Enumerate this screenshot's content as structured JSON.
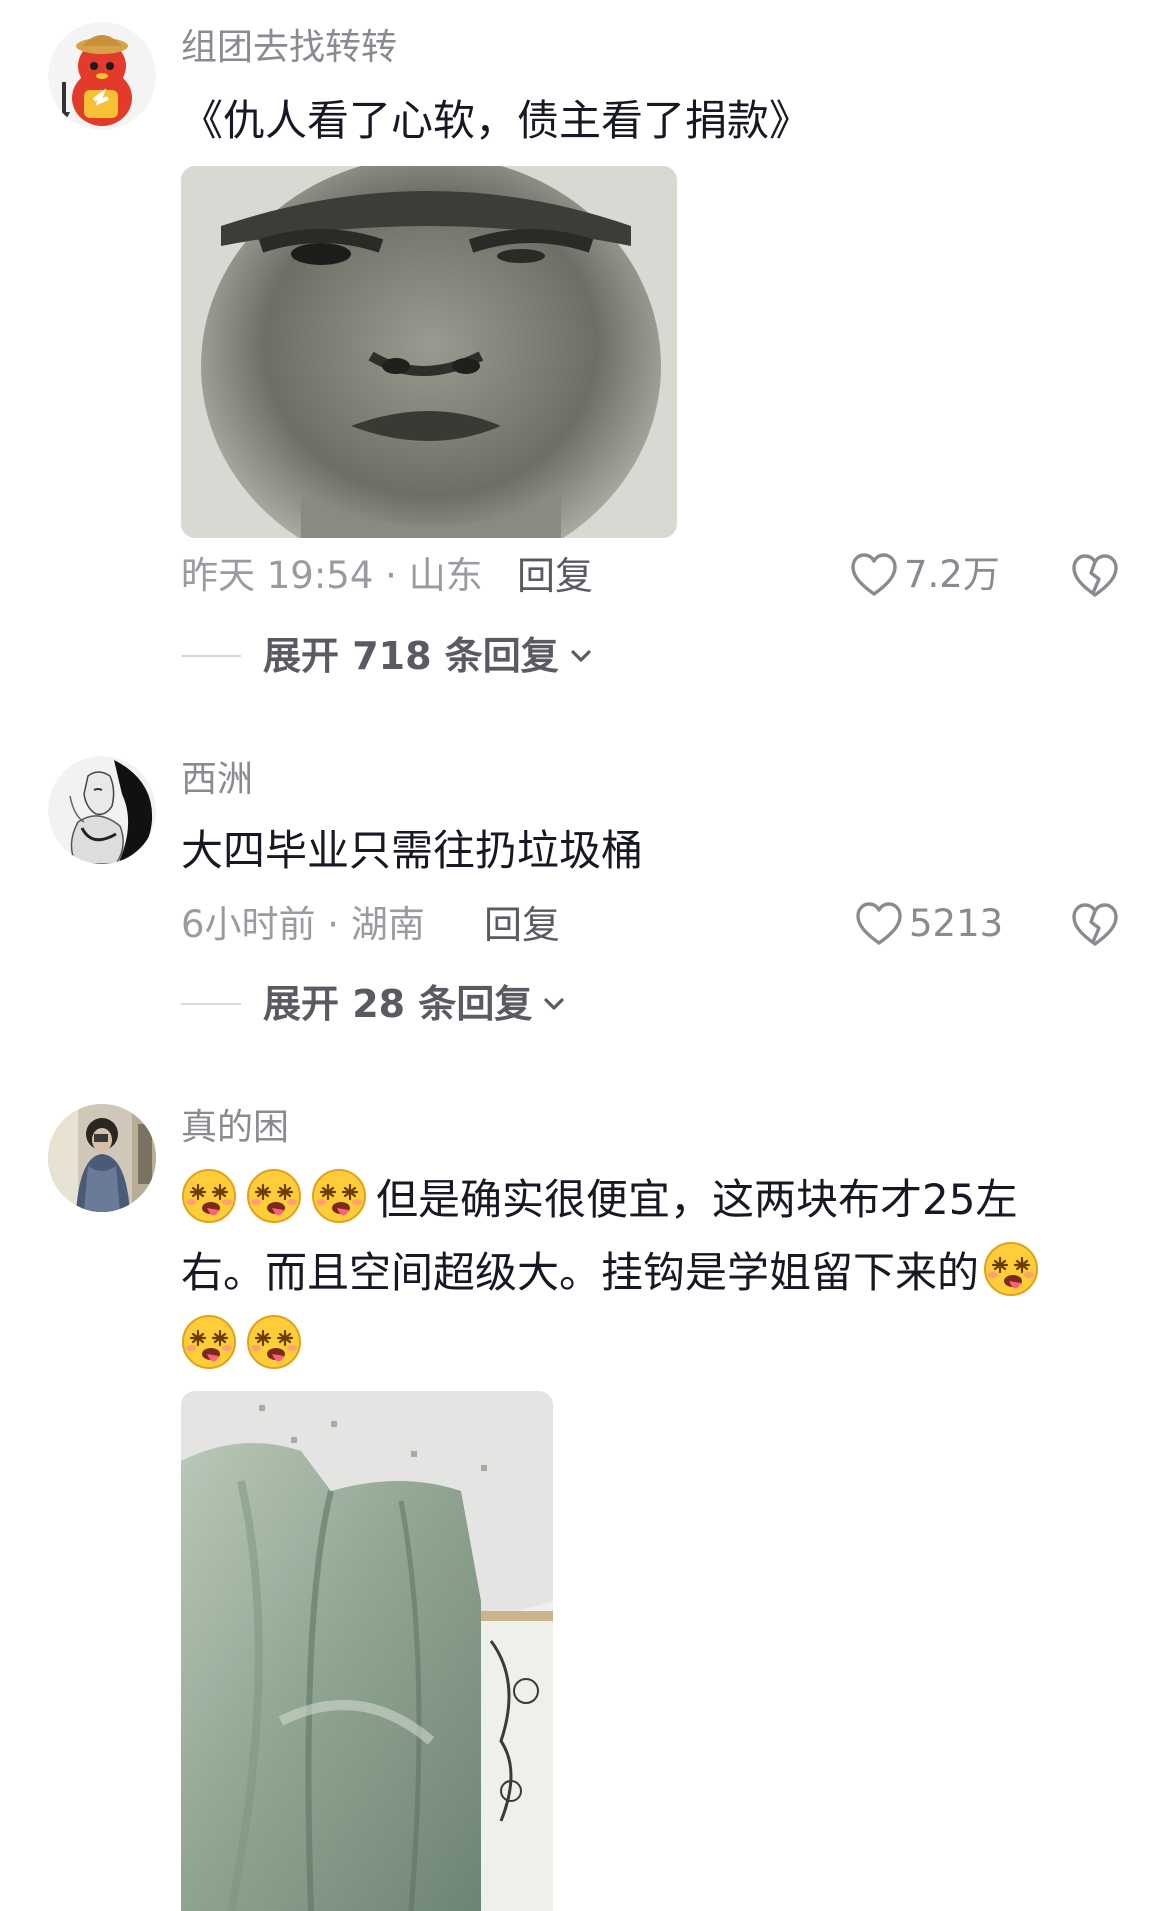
{
  "comments": [
    {
      "username": "组团去找转转",
      "text": "《仇人看了心软，债主看了捐款》",
      "time": "昨天 19:54",
      "location": "山东",
      "reply_label": "回复",
      "likes": "7.2万",
      "expand_label": "展开 718 条回复",
      "avatar_icon": "cartoon-bird-icon",
      "media_icon": "face-photo"
    },
    {
      "username": "西洲",
      "text": "大四毕业只需往扔垃圾桶",
      "time": "6小时前",
      "location": "湖南",
      "reply_label": "回复",
      "likes": "5213",
      "expand_label": "展开 28 条回复",
      "avatar_icon": "sketch-portrait-icon"
    },
    {
      "username": "真的困",
      "text_line1": "但是确实很便宜，这两块布才25左",
      "text_line2": "右。而且空间超级大。挂钩是学姐留下来的",
      "avatar_icon": "person-photo-icon",
      "emoji_icon": "dizzy-tongue-emoji",
      "media_icon": "dorm-curtain-photo"
    }
  ],
  "separator": " · ",
  "colors": {
    "text": "#161823",
    "secondary": "#8a8b91",
    "meta": "#9a9ba1"
  }
}
